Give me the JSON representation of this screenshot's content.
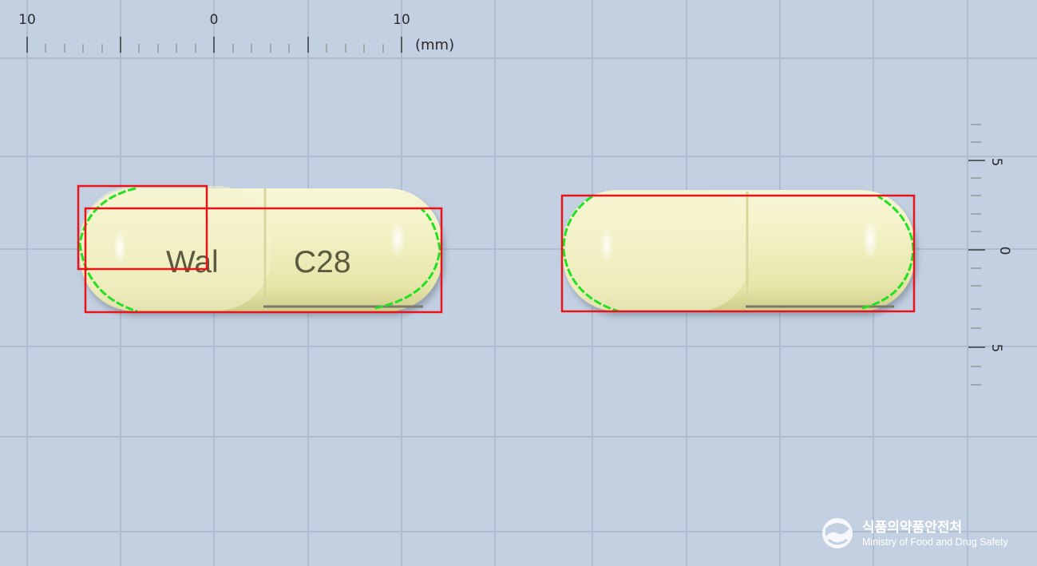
{
  "top_ruler": {
    "labels": [
      "10",
      "0",
      "10"
    ],
    "unit": "(mm)"
  },
  "side_ruler": {
    "labels": [
      "5",
      "0",
      "5"
    ]
  },
  "capsule_left": {
    "imprint_cap": "Wal",
    "imprint_body": "C28"
  },
  "watermark": {
    "korean": "식품의약품안전처",
    "english": "Ministry of Food and Drug Safety"
  },
  "colors": {
    "background": "#c3d0e2",
    "grid": "#aebcd0",
    "capsule": "#f0efbc",
    "detection_box": "#e8141a",
    "contour": "#22e022"
  }
}
